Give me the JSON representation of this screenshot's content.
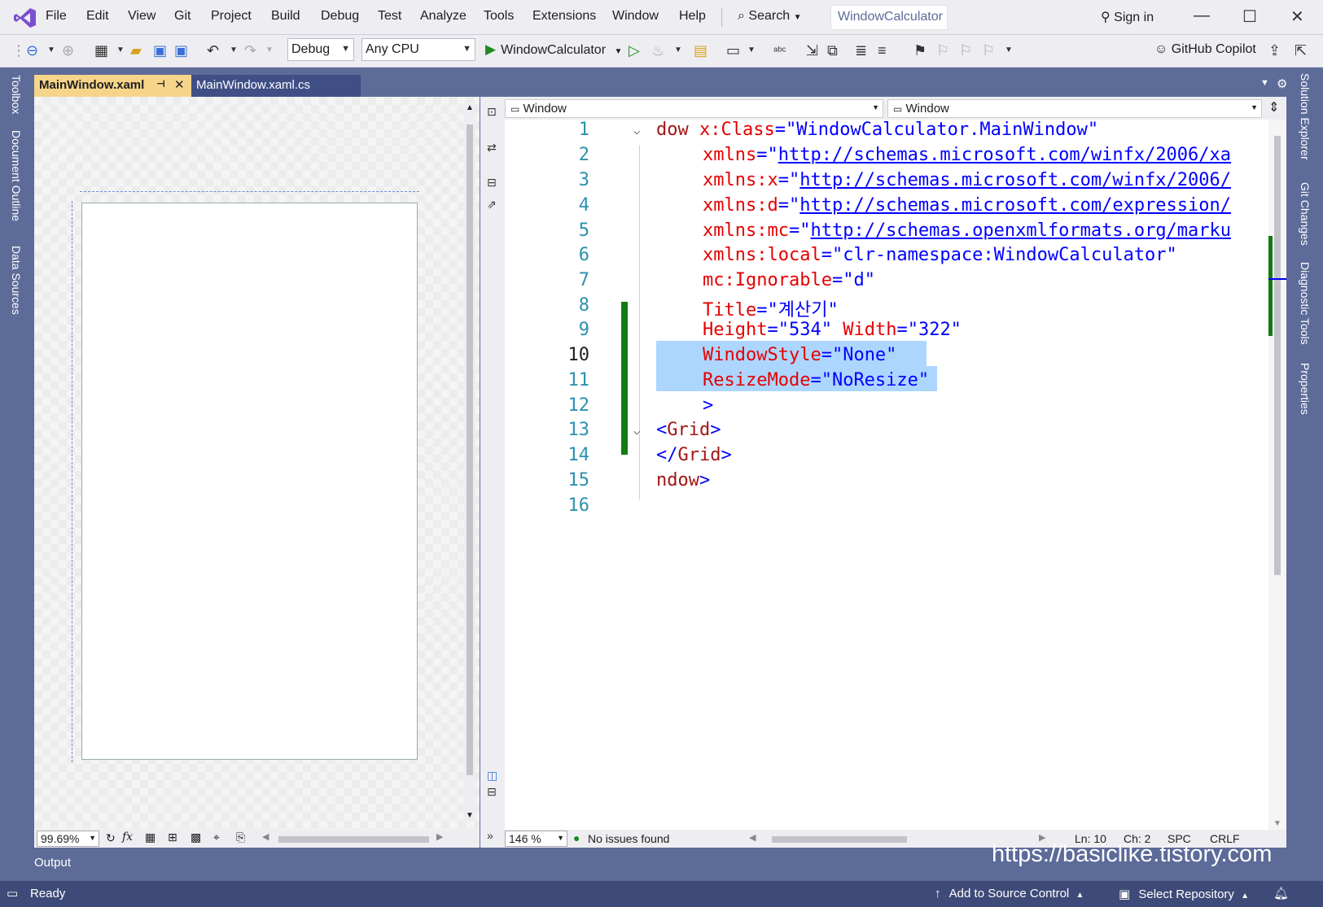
{
  "menu": [
    "File",
    "Edit",
    "View",
    "Git",
    "Project",
    "Build",
    "Debug",
    "Test",
    "Analyze",
    "Tools",
    "Extensions",
    "Window",
    "Help"
  ],
  "search_label": "Search",
  "solution_name": "WindowCalculator",
  "sign_in": "Sign in",
  "toolbar": {
    "config": "Debug",
    "platform": "Any CPU",
    "run_target": "WindowCalculator",
    "copilot": "GitHub Copilot"
  },
  "left_rail": [
    "Toolbox",
    "Document Outline",
    "Data Sources"
  ],
  "right_rail": [
    "Solution Explorer",
    "Git Changes",
    "Diagnostic Tools",
    "Properties"
  ],
  "tabs": [
    {
      "label": "MainWindow.xaml",
      "active": true
    },
    {
      "label": "MainWindow.xaml.cs",
      "active": false
    }
  ],
  "designer": {
    "zoom": "99.69%"
  },
  "nav": {
    "left": "Window",
    "right": "Window"
  },
  "code_lines": [
    {
      "n": "1"
    },
    {
      "n": "2"
    },
    {
      "n": "3"
    },
    {
      "n": "4"
    },
    {
      "n": "5"
    },
    {
      "n": "6"
    },
    {
      "n": "7"
    },
    {
      "n": "8"
    },
    {
      "n": "9"
    },
    {
      "n": "10"
    },
    {
      "n": "11"
    },
    {
      "n": "12"
    },
    {
      "n": "13"
    },
    {
      "n": "14"
    },
    {
      "n": "15"
    },
    {
      "n": "16"
    }
  ],
  "code": {
    "l1": {
      "tag": "dow",
      "attr": "x:Class",
      "val": "\"WindowCalculator.MainWindow\""
    },
    "l2": {
      "attr": "xmlns",
      "eq": "=\"",
      "url": "http://schemas.microsoft.com/winfx/2006/xa"
    },
    "l3": {
      "attr": "xmlns:x",
      "eq": "=\"",
      "url": "http://schemas.microsoft.com/winfx/2006/"
    },
    "l4": {
      "attr": "xmlns:d",
      "eq": "=\"",
      "url": "http://schemas.microsoft.com/expression/"
    },
    "l5": {
      "attr": "xmlns:mc",
      "eq": "=\"",
      "url": "http://schemas.openxmlformats.org/marku"
    },
    "l6": {
      "attr": "xmlns:local",
      "val": "\"clr-namespace:WindowCalculator\""
    },
    "l7": {
      "attr": "mc:Ignorable",
      "val": "\"d\""
    },
    "l8": {
      "attr": "Title",
      "val": "\"계산기\""
    },
    "l9": {
      "attr1": "Height",
      "val1": "\"534\"",
      "attr2": "Width",
      "val2": "\"322\""
    },
    "l10": {
      "attr": "WindowStyle",
      "val": "\"None\""
    },
    "l11": {
      "attr": "ResizeMode",
      "val": "\"NoResize\""
    },
    "l12": {
      "text": ">"
    },
    "l13": {
      "open": "<",
      "tag": "Grid",
      "close": ">"
    },
    "l14": {
      "open": "</",
      "tag": "Grid",
      "close": ">"
    },
    "l15": {
      "tag": "ndow",
      "close": ">"
    }
  },
  "editor_status": {
    "zoom": "146 %",
    "issues": "No issues found",
    "ln": "Ln: 10",
    "ch": "Ch: 2",
    "spc": "SPC",
    "crlf": "CRLF"
  },
  "output": "Output",
  "watermark": "https://basiclike.tistory.com",
  "statusbar": {
    "ready": "Ready",
    "source_control": "Add to Source Control",
    "repository": "Select Repository"
  }
}
